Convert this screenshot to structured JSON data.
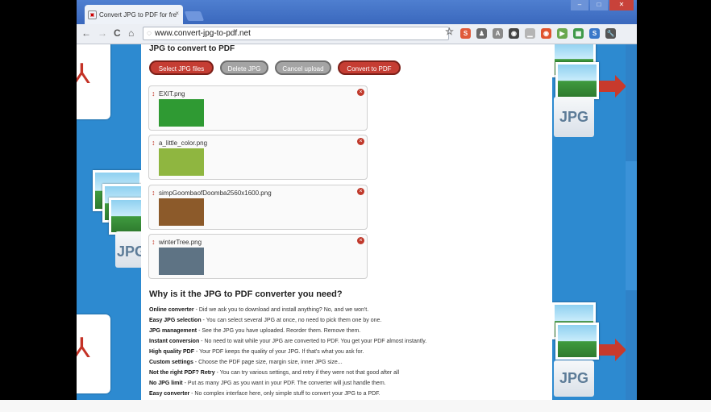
{
  "browser": {
    "tab_title": "Convert JPG to PDF for fre",
    "tab_close": "×",
    "address": "www.convert-jpg-to-pdf.net",
    "window_controls": [
      "–",
      "□",
      "✕"
    ]
  },
  "nav": {
    "back": "←",
    "forward": "→",
    "reload": "C",
    "home": "⌂"
  },
  "toolbar_icons": [
    {
      "name": "bookmark-star-icon",
      "glyph": "☆",
      "color": "#777777"
    },
    {
      "name": "ext-red-icon",
      "glyph": "S",
      "color": "#e05a3a"
    },
    {
      "name": "ext-gray-icon",
      "glyph": "♟",
      "color": "#6a6a6a"
    },
    {
      "name": "ext-font-icon",
      "glyph": "A",
      "color": "#8a8a8a"
    },
    {
      "name": "ext-dark-icon",
      "glyph": "◉",
      "color": "#444444"
    },
    {
      "name": "ext-bar-icon",
      "glyph": "▁",
      "color": "#b5b5b5"
    },
    {
      "name": "ext-orange-icon",
      "glyph": "◉",
      "color": "#e0532e"
    },
    {
      "name": "ext-green-icon",
      "glyph": "▶",
      "color": "#6aa84f"
    },
    {
      "name": "ext-green2-icon",
      "glyph": "▦",
      "color": "#3f9a4a"
    },
    {
      "name": "ext-blue-icon",
      "glyph": "S",
      "color": "#3a78c9"
    },
    {
      "name": "wrench-icon",
      "glyph": "🔧",
      "color": "#555555"
    }
  ],
  "page": {
    "title": "JPG to convert to PDF",
    "buttons": {
      "select": "Select JPG files",
      "delete": "Delete JPG",
      "cancel": "Cancel upload",
      "convert": "Convert to PDF"
    },
    "files": [
      {
        "name": "EXIT.png",
        "thumb": "#2f9a33"
      },
      {
        "name": "a_little_color.png",
        "thumb": "#8fb640"
      },
      {
        "name": "simpGoombaofDoomba2560x1600.png",
        "thumb": "#8c5a2a"
      },
      {
        "name": "winterTree.png",
        "thumb": "#5e7384"
      }
    ],
    "section_title": "Why is it the JPG to PDF converter you need?",
    "features": [
      {
        "label": "Online converter",
        "text": " - Did we ask you to download and install anything? No, and we won't."
      },
      {
        "label": "Easy JPG selection",
        "text": " - You can select several JPG at once, no need to pick them one by one."
      },
      {
        "label": "JPG management",
        "text": " - See the JPG you have uploaded. Reorder them. Remove them."
      },
      {
        "label": "Instant conversion",
        "text": " - No need to wait while your JPG are converted to PDF. You get your PDF almost instantly."
      },
      {
        "label": "High quality PDF",
        "text": " - Your PDF keeps the quality of your JPG. If that's what you ask for."
      },
      {
        "label": "Custom settings",
        "text": " - Choose the PDF page size, margin size, inner JPG size..."
      },
      {
        "label": "Not the right PDF? Retry",
        "text": " - You can try various settings, and retry if they were not that good after all"
      },
      {
        "label": "No JPG limit",
        "text": " - Put as many JPG as you want in your PDF. The converter will just handle them."
      },
      {
        "label": "Easy converter",
        "text": " - No complex interface here, only simple stuff to convert your JPG to a PDF."
      }
    ]
  },
  "decor": {
    "jpg_left": "JPG",
    "jpg_right_top": "JPG",
    "jpg_right_bottom": "JPG"
  }
}
